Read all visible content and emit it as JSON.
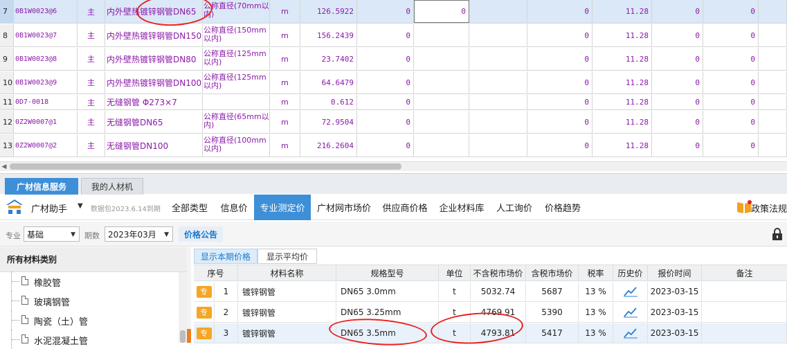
{
  "top_grid": {
    "rows": [
      {
        "rownum": "7",
        "code": "0B1W0023@6",
        "flag": "主",
        "name": "内外壁热镀锌钢管DN65",
        "spec": "公称直径(70mm以内)",
        "unit": "m",
        "qty": "126.5922",
        "v1": "0",
        "v2": "0",
        "v3": "0",
        "v4": "11.28",
        "v5": "0",
        "v6": "0"
      },
      {
        "rownum": "8",
        "code": "0B1W0023@7",
        "flag": "主",
        "name": "内外壁热镀锌钢管DN150",
        "spec": "公称直径(150mm以内)",
        "unit": "m",
        "qty": "156.2439",
        "v1": "0",
        "v2": "",
        "v3": "0",
        "v4": "11.28",
        "v5": "0",
        "v6": "0"
      },
      {
        "rownum": "9",
        "code": "0B1W0023@8",
        "flag": "主",
        "name": "内外壁热镀锌钢管DN80",
        "spec": "公称直径(125mm以内)",
        "unit": "m",
        "qty": "23.7402",
        "v1": "0",
        "v2": "",
        "v3": "0",
        "v4": "11.28",
        "v5": "0",
        "v6": "0"
      },
      {
        "rownum": "10",
        "code": "0B1W0023@9",
        "flag": "主",
        "name": "内外壁热镀锌钢管DN100",
        "spec": "公称直径(125mm以内)",
        "unit": "m",
        "qty": "64.6479",
        "v1": "0",
        "v2": "",
        "v3": "0",
        "v4": "11.28",
        "v5": "0",
        "v6": "0"
      },
      {
        "rownum": "11",
        "code": "0D7-0018",
        "flag": "主",
        "name": "无缝钢管 Φ273×7",
        "spec": "",
        "unit": "m",
        "qty": "0.612",
        "v1": "0",
        "v2": "",
        "v3": "0",
        "v4": "11.28",
        "v5": "0",
        "v6": "0"
      },
      {
        "rownum": "12",
        "code": "0Z2W0007@1",
        "flag": "主",
        "name": "无缝钢管DN65",
        "spec": "公称直径(65mm以内)",
        "unit": "m",
        "qty": "72.9504",
        "v1": "0",
        "v2": "",
        "v3": "0",
        "v4": "11.28",
        "v5": "0",
        "v6": "0"
      },
      {
        "rownum": "13",
        "code": "0Z2W0007@2",
        "flag": "主",
        "name": "无缝钢管DN100",
        "spec": "公称直径(100mm以内)",
        "unit": "m",
        "qty": "216.2604",
        "v1": "0",
        "v2": "",
        "v3": "0",
        "v4": "11.28",
        "v5": "0",
        "v6": "0"
      }
    ]
  },
  "panel_tabs": [
    "广材信息服务",
    "我的人材机"
  ],
  "toolbar": {
    "brand": "广材助手",
    "brand_caret": "▼",
    "package_info": "数据包2023.6.14到期",
    "nav": [
      "全部类型",
      "信息价",
      "专业测定价",
      "广材网市场价",
      "供应商价格",
      "企业材料库",
      "人工询价",
      "价格趋势"
    ],
    "policy": "政策法规"
  },
  "filter": {
    "major_label": "专业",
    "major_value": "基础",
    "period_label": "期数",
    "period_value": "2023年03月",
    "announcement": "价格公告"
  },
  "tree": {
    "header": "所有材料类别",
    "items": [
      "橡胶管",
      "玻璃钢管",
      "陶瓷（土）管",
      "水泥混凝土管"
    ]
  },
  "price_table": {
    "toggle_current": "显示本期价格",
    "toggle_avg": "显示平均价",
    "columns": [
      "序号",
      "材料名称",
      "规格型号",
      "单位",
      "不含税市场价",
      "含税市场价",
      "税率",
      "历史价",
      "报价时间",
      "备注"
    ],
    "rows": [
      {
        "badge": "专",
        "idx": "1",
        "name": "镀锌钢管",
        "spec": "DN65  3.0mm",
        "unit": "t",
        "price_ex": "5032.74",
        "price_in": "5687",
        "tax": "13 %",
        "date": "2023-03-15",
        "note": ""
      },
      {
        "badge": "专",
        "idx": "2",
        "name": "镀锌钢管",
        "spec": "DN65  3.25mm",
        "unit": "t",
        "price_ex": "4769.91",
        "price_in": "5390",
        "tax": "13 %",
        "date": "2023-03-15",
        "note": ""
      },
      {
        "badge": "专",
        "idx": "3",
        "name": "镀锌钢管",
        "spec": "DN65  3.5mm",
        "unit": "t",
        "price_ex": "4793.81",
        "price_in": "5417",
        "tax": "13 %",
        "date": "2023-03-15",
        "note": ""
      }
    ]
  },
  "colors": {
    "accent": "#3d8fd7",
    "text_purple": "#8b1aa8",
    "annotation_red": "#e8201e",
    "badge_orange": "#f5a623"
  }
}
